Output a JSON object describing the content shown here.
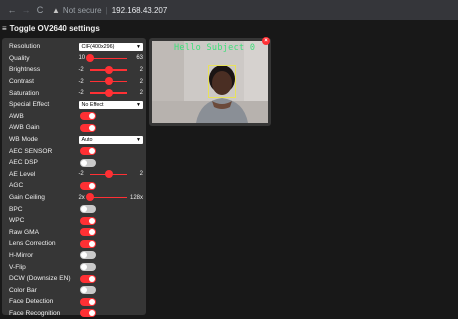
{
  "browser": {
    "back_glyph": "←",
    "forward_glyph": "→",
    "reload_glyph": "C",
    "warning_glyph": "▲",
    "security_label": "Not secure",
    "separator": "|",
    "url": "192.168.43.207"
  },
  "header": {
    "menu_glyph": "≡",
    "title": "Toggle OV2640 settings"
  },
  "settings": {
    "resolution": {
      "label": "Resolution",
      "value": "CIF(400x296)"
    },
    "quality": {
      "label": "Quality",
      "min": "10",
      "max": "63",
      "level": 0.0
    },
    "brightness": {
      "label": "Brightness",
      "min": "-2",
      "max": "2",
      "level": 0.5
    },
    "contrast": {
      "label": "Contrast",
      "min": "-2",
      "max": "2",
      "level": 0.5
    },
    "saturation": {
      "label": "Saturation",
      "min": "-2",
      "max": "2",
      "level": 0.5
    },
    "special_effect": {
      "label": "Special Effect",
      "value": "No Effect"
    },
    "awb": {
      "label": "AWB",
      "on": true
    },
    "awb_gain": {
      "label": "AWB Gain",
      "on": true
    },
    "wb_mode": {
      "label": "WB Mode",
      "value": "Auto"
    },
    "aec_sensor": {
      "label": "AEC SENSOR",
      "on": true
    },
    "aec_dsp": {
      "label": "AEC DSP",
      "on": false
    },
    "ae_level": {
      "label": "AE Level",
      "min": "-2",
      "max": "2",
      "level": 0.5
    },
    "agc": {
      "label": "AGC",
      "on": true
    },
    "gain_ceiling": {
      "label": "Gain Ceiling",
      "min": "2x",
      "max": "128x",
      "level": 0.0
    },
    "bpc": {
      "label": "BPC",
      "on": false
    },
    "wpc": {
      "label": "WPC",
      "on": true
    },
    "raw_gma": {
      "label": "Raw GMA",
      "on": true
    },
    "lens_correction": {
      "label": "Lens Correction",
      "on": true
    },
    "h_mirror": {
      "label": "H-Mirror",
      "on": false
    },
    "v_flip": {
      "label": "V-Flip",
      "on": false
    },
    "dcw": {
      "label": "DCW (Downsize EN)",
      "on": true
    },
    "color_bar": {
      "label": "Color Bar",
      "on": false
    },
    "face_detection": {
      "label": "Face Detection",
      "on": true
    },
    "face_recognition": {
      "label": "Face Recognition",
      "on": true
    }
  },
  "stream": {
    "overlay_text": "Hello Subject 0",
    "close_glyph": "×"
  },
  "colors": {
    "accent": "#ff3034",
    "panel": "#363636",
    "background": "#181818",
    "overlay_text": "#3ee07a",
    "face_box": "#e8e25a"
  },
  "icons": {
    "back": "back-arrow-icon",
    "forward": "forward-arrow-icon",
    "reload": "reload-icon",
    "warning": "warning-icon",
    "menu": "hamburger-icon",
    "close": "close-icon"
  }
}
